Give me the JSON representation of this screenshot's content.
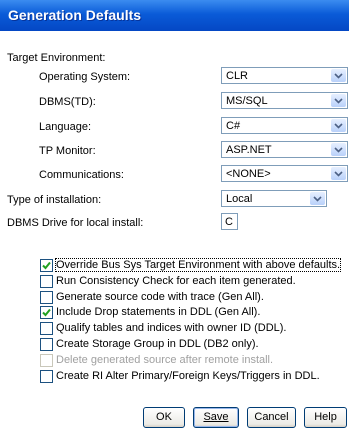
{
  "window": {
    "title": "Generation Defaults"
  },
  "target_env": {
    "heading": "Target Environment:",
    "os": {
      "label": "Operating System:",
      "value": "CLR"
    },
    "dbms": {
      "label": "DBMS(TD):",
      "value": "MS/SQL"
    },
    "language": {
      "label": "Language:",
      "value": "C#"
    },
    "tp_monitor": {
      "label": "TP Monitor:",
      "value": "ASP.NET"
    },
    "communications": {
      "label": "Communications:",
      "value": "<NONE>"
    }
  },
  "install_type": {
    "label": "Type of installation:",
    "value": "Local"
  },
  "dbms_drive": {
    "label": "DBMS Drive for local install:",
    "value": "C"
  },
  "options": [
    {
      "label": "Override Bus Sys Target Environment with above defaults.",
      "checked": true,
      "enabled": true
    },
    {
      "label": "Run Consistency Check for each item generated.",
      "checked": false,
      "enabled": true
    },
    {
      "label": "Generate source code with trace (Gen All).",
      "checked": false,
      "enabled": true
    },
    {
      "label": "Include Drop statements in DDL (Gen All).",
      "checked": true,
      "enabled": true
    },
    {
      "label": "Qualify tables and indices with owner ID (DDL).",
      "checked": false,
      "enabled": true
    },
    {
      "label": "Create Storage Group in DDL (DB2 only).",
      "checked": false,
      "enabled": true
    },
    {
      "label": "Delete generated source after remote install.",
      "checked": false,
      "enabled": false
    },
    {
      "label": "Create RI Alter Primary/Foreign Keys/Triggers in DDL.",
      "checked": false,
      "enabled": true
    }
  ],
  "buttons": {
    "ok": "OK",
    "save": "Save",
    "cancel": "Cancel",
    "help": "Help"
  },
  "colors": {
    "title_bar": "#0a5bd8",
    "check_mark": "#21a121"
  }
}
